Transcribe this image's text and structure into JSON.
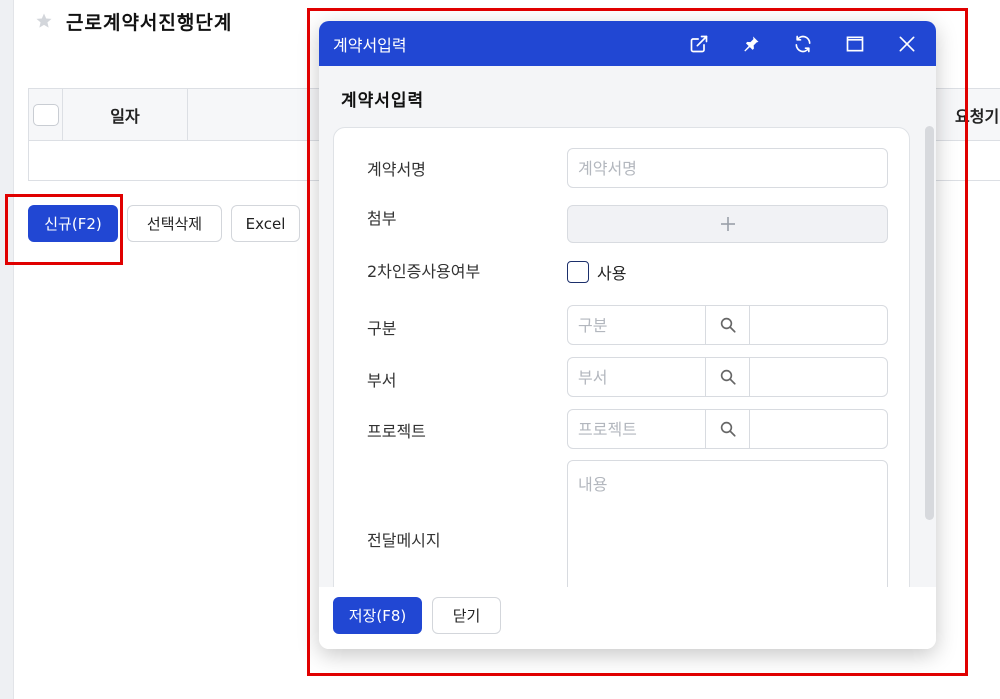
{
  "page": {
    "title": "근로계약서진행단계",
    "grid_headers": {
      "date": "일자",
      "requester": "요청기"
    },
    "actions": {
      "new": "신규(F2)",
      "delete_selected": "선택삭제",
      "excel": "Excel"
    }
  },
  "modal": {
    "window_title": "계약서입력",
    "header_icons": [
      "popout-icon",
      "pin-icon",
      "refresh-icon",
      "maximize-icon",
      "close-icon"
    ],
    "section_title": "계약서입력",
    "fields": {
      "contract_name": {
        "label": "계약서명",
        "placeholder": "계약서명"
      },
      "attachment": {
        "label": "첨부"
      },
      "two_factor": {
        "label": "2차인증사용여부",
        "option": "사용",
        "checked": false
      },
      "category": {
        "label": "구분",
        "placeholder": "구분"
      },
      "department": {
        "label": "부서",
        "placeholder": "부서"
      },
      "project": {
        "label": "프로젝트",
        "placeholder": "프로젝트"
      },
      "message": {
        "label": "전달메시지",
        "placeholder": "내용"
      }
    },
    "footer": {
      "save": "저장(F8)",
      "close": "닫기"
    }
  },
  "colors": {
    "primary": "#2147d3",
    "highlight": "#e00000",
    "body_bg": "#f4f5f7"
  }
}
